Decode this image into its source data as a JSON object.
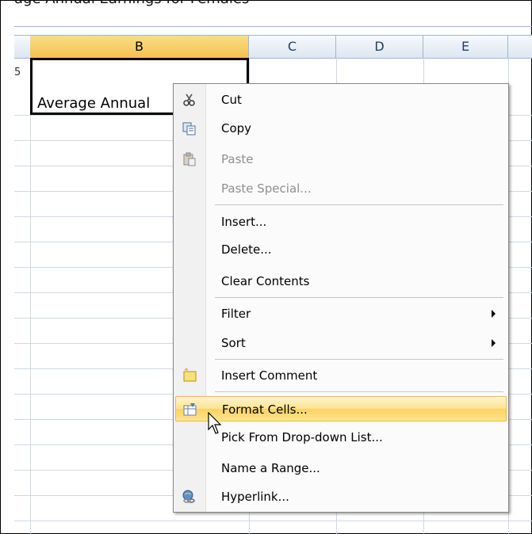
{
  "formula_bar_text": "age Annual Earnings for Females",
  "columns": [
    "B",
    "C",
    "D",
    "E"
  ],
  "selected_column": "B",
  "row_number_fragment": "5",
  "cell_b1": {
    "value": "Average Annual"
  },
  "context_menu": {
    "items": [
      {
        "key": "cut",
        "label": "Cut",
        "icon": "scissors-icon",
        "disabled": false
      },
      {
        "key": "copy",
        "label": "Copy",
        "icon": "copy-icon",
        "disabled": false
      },
      {
        "key": "paste",
        "label": "Paste",
        "icon": "paste-icon",
        "disabled": true
      },
      {
        "key": "paste_special",
        "label": "Paste Special...",
        "disabled": true
      },
      {
        "key": "insert",
        "label": "Insert..."
      },
      {
        "key": "delete",
        "label": "Delete..."
      },
      {
        "key": "clear_contents",
        "label": "Clear Contents"
      },
      {
        "key": "filter",
        "label": "Filter",
        "submenu": true
      },
      {
        "key": "sort",
        "label": "Sort",
        "submenu": true
      },
      {
        "key": "insert_comment",
        "label": "Insert Comment",
        "icon": "comment-icon"
      },
      {
        "key": "format_cells",
        "label": "Format Cells...",
        "icon": "format-cells-icon",
        "highlighted": true
      },
      {
        "key": "pick_list",
        "label": "Pick From Drop-down List..."
      },
      {
        "key": "name_range",
        "label": "Name a Range..."
      },
      {
        "key": "hyperlink",
        "label": "Hyperlink...",
        "icon": "hyperlink-icon"
      }
    ]
  },
  "colors": {
    "highlight": "#fcd162",
    "header_selected": "#f6c150",
    "gridline": "#d0d7e5"
  }
}
